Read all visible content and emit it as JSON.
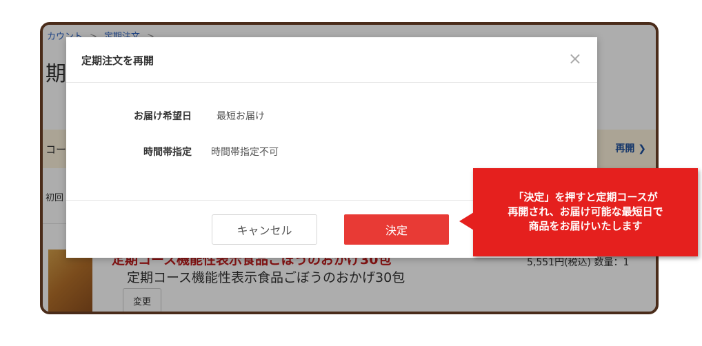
{
  "background": {
    "breadcrumb": [
      "カウント",
      "定期注文"
    ],
    "page_title": "期注",
    "banner_left": "コー",
    "banner_resume": "再開",
    "first_label": "初回",
    "product_red": "定期コース機能性表示食品ごぼうのおかげ30包",
    "product_name": "定期コース機能性表示食品ごぼうのおかげ30包",
    "product_price": "5,551円(税込)  数量：1",
    "change_label": "変更"
  },
  "modal": {
    "title": "定期注文を再開",
    "close_glyph": "×",
    "rows": [
      {
        "label": "お届け希望日",
        "value": "最短お届け"
      },
      {
        "label": "時間帯指定",
        "value": "時間帯指定不可"
      }
    ],
    "cancel_label": "キャンセル",
    "decide_label": "決定"
  },
  "callout": {
    "lines": [
      "「決定」を押すと定期コースが",
      "再開され、お届け可能な最短日で",
      "商品をお届けいたします"
    ]
  },
  "colors": {
    "accent_red": "#e83a35",
    "callout_red": "#e5201e",
    "frame_brown": "#4a2c1a"
  }
}
